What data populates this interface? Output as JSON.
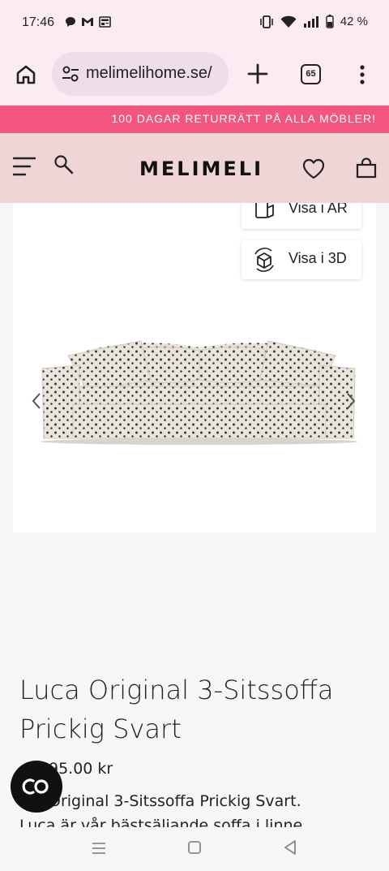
{
  "status_bar": {
    "time": "17:46",
    "battery": "42 %",
    "left_icons": [
      "chat-bubble-icon",
      "gmail-icon",
      "news-icon"
    ],
    "right_icons": [
      "vibrate-icon",
      "wifi-icon",
      "signal-icon",
      "battery-icon"
    ]
  },
  "browser": {
    "url": "melimelihome.se/",
    "tab_count": "65"
  },
  "promo": {
    "text": "100 DAGAR RETURRÄTT PÅ ALLA MÖBLER!"
  },
  "header": {
    "logo": "MELIMELI"
  },
  "gallery": {
    "ar_label": "Visa i AR",
    "view3d_label": "Visa i 3D"
  },
  "product": {
    "title": "Luca Original 3-Sitssoffa Prickig Svart",
    "price": "95.00 kr",
    "description_line1": "Original 3-Sitssoffa Prickig Svart.",
    "description_line2": "Luca är vår bästsäljande soffa i linne"
  },
  "colors": {
    "chrome_bg": "#fcebf3",
    "promo_bg": "#f3557f",
    "header_bg": "#efd5d6",
    "url_bg": "#efdde9"
  }
}
